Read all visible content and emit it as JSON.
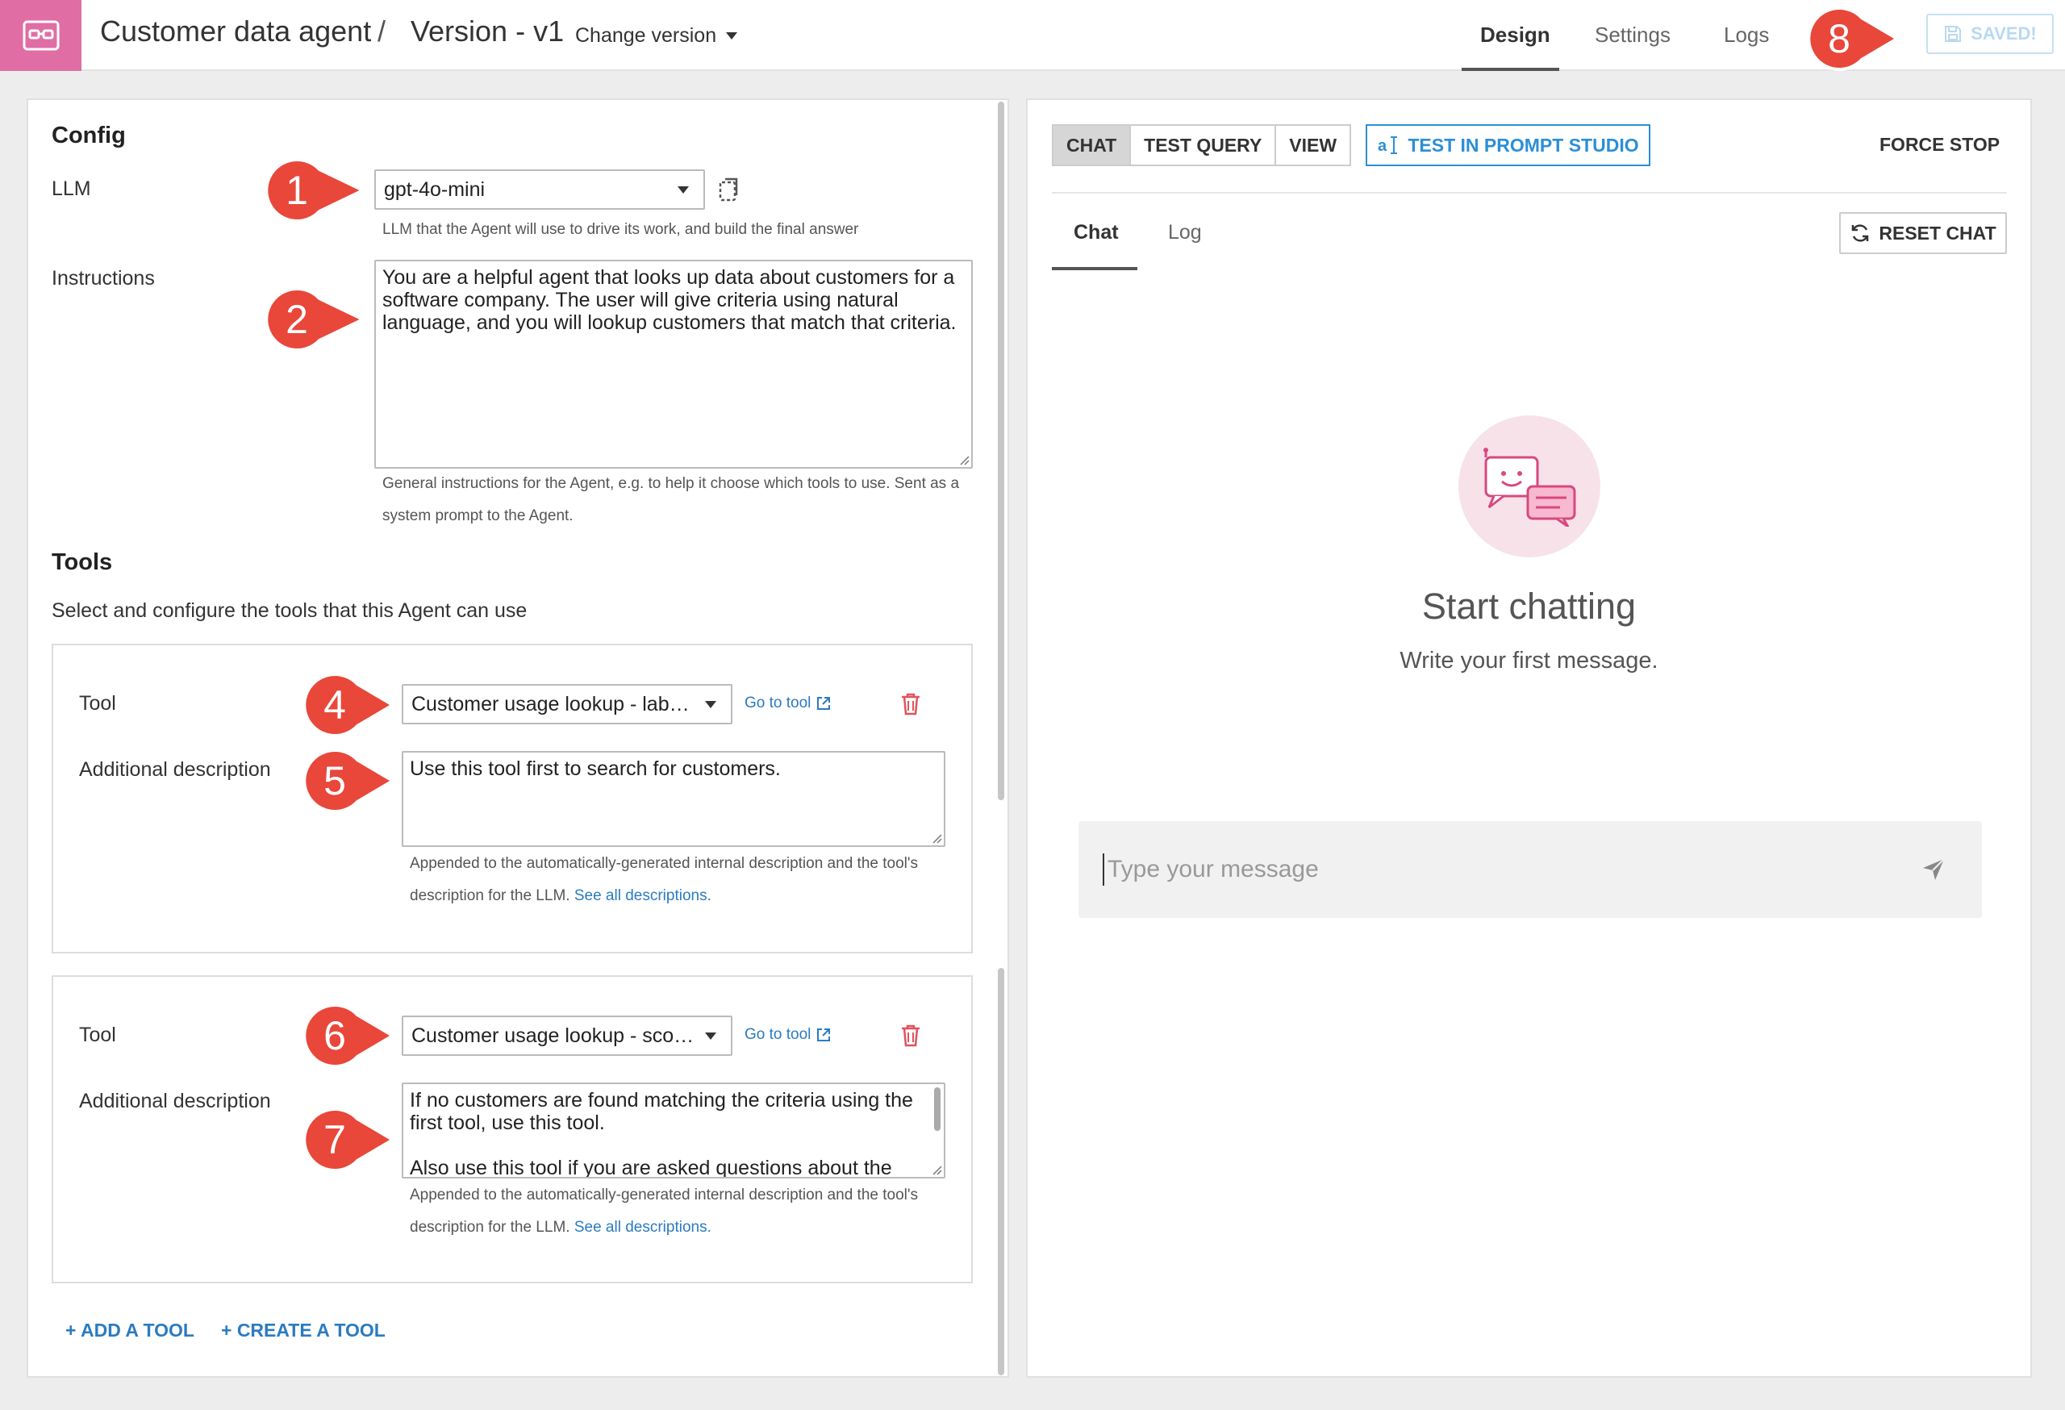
{
  "header": {
    "title": "Customer data agent",
    "separator": "/",
    "version": "Version - v1",
    "change_version": "Change version",
    "tabs": {
      "design": "Design",
      "settings": "Settings",
      "logs": "Logs"
    },
    "saved_label": "SAVED!"
  },
  "config": {
    "heading": "Config",
    "llm_label": "LLM",
    "llm_value": "gpt-4o-mini",
    "llm_hint": "LLM that the Agent will use to drive its work, and build the final answer",
    "instructions_label": "Instructions",
    "instructions_value": "You are a helpful agent that looks up data about customers for a software company. The user will give criteria using natural language, and you will lookup customers that match that criteria.",
    "instructions_hint": "General instructions for the Agent, e.g. to help it choose which tools to use. Sent as a system prompt to the Agent."
  },
  "tools": {
    "heading": "Tools",
    "subtitle": "Select and configure the tools that this Agent can use",
    "tool_label": "Tool",
    "desc_label": "Additional description",
    "goto_label": "Go to tool",
    "hint_text": "Appended to the automatically-generated internal description and the tool's description for the LLM.",
    "see_all": "See all descriptions.",
    "items": [
      {
        "tool_value": "Customer usage lookup - labe…",
        "description": "Use this tool first to search for customers."
      },
      {
        "tool_value": "Customer usage lookup - scor…",
        "description_line1": "If no customers are found matching the criteria using the first tool, use this tool.",
        "description_line2": "Also use this tool if you are asked questions about the"
      }
    ],
    "add_tool": "+ ADD A TOOL",
    "create_tool": "+ CREATE A TOOL"
  },
  "chat_panel": {
    "modes": [
      "CHAT",
      "TEST QUERY",
      "VIEW"
    ],
    "prompt_studio": "TEST IN PROMPT STUDIO",
    "force_stop": "FORCE STOP",
    "sub_tabs": {
      "chat": "Chat",
      "log": "Log"
    },
    "reset_chat": "RESET CHAT",
    "empty_title": "Start chatting",
    "empty_subtitle": "Write your first message.",
    "input_placeholder": "Type your message"
  },
  "markers": [
    "1",
    "2",
    "4",
    "5",
    "6",
    "7",
    "8"
  ],
  "colors": {
    "logo_bg": "#e06ea4",
    "link_blue": "#2b7bc0",
    "marker_red": "#e8473a",
    "trash_red": "#e0525e"
  }
}
